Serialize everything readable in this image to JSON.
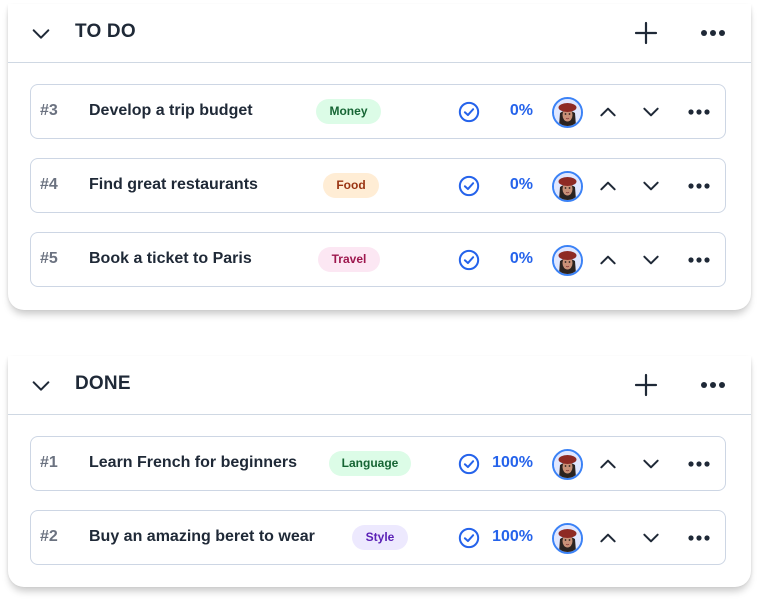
{
  "sections": [
    {
      "title": "TO DO",
      "add_icon": "plus-icon",
      "more_icon": "more-horizontal-icon",
      "collapse_icon": "chevron-down-icon",
      "tasks": [
        {
          "id": "#3",
          "title": "Develop a trip budget",
          "tag": {
            "label": "Money",
            "bg": "#dcfce7",
            "fg": "#166534"
          },
          "progress": "0%"
        },
        {
          "id": "#4",
          "title": "Find great restaurants",
          "tag": {
            "label": "Food",
            "bg": "#ffedd5",
            "fg": "#9a3412"
          },
          "progress": "0%"
        },
        {
          "id": "#5",
          "title": "Book a ticket to Paris",
          "tag": {
            "label": "Travel",
            "bg": "#fce7f3",
            "fg": "#9d174d"
          },
          "progress": "0%"
        }
      ]
    },
    {
      "title": "DONE",
      "add_icon": "plus-icon",
      "more_icon": "more-horizontal-icon",
      "collapse_icon": "chevron-down-icon",
      "tasks": [
        {
          "id": "#1",
          "title": "Learn French for beginners",
          "tag": {
            "label": "Language",
            "bg": "#dcfce7",
            "fg": "#166534"
          },
          "progress": "100%"
        },
        {
          "id": "#2",
          "title": "Buy an amazing beret to wear",
          "tag": {
            "label": "Style",
            "bg": "#ede9fe",
            "fg": "#5b21b6"
          },
          "progress": "100%"
        }
      ]
    }
  ],
  "colors": {
    "accent": "#2563eb",
    "text": "#1f2937",
    "muted": "#6b7280",
    "border": "#cdd6e4"
  }
}
